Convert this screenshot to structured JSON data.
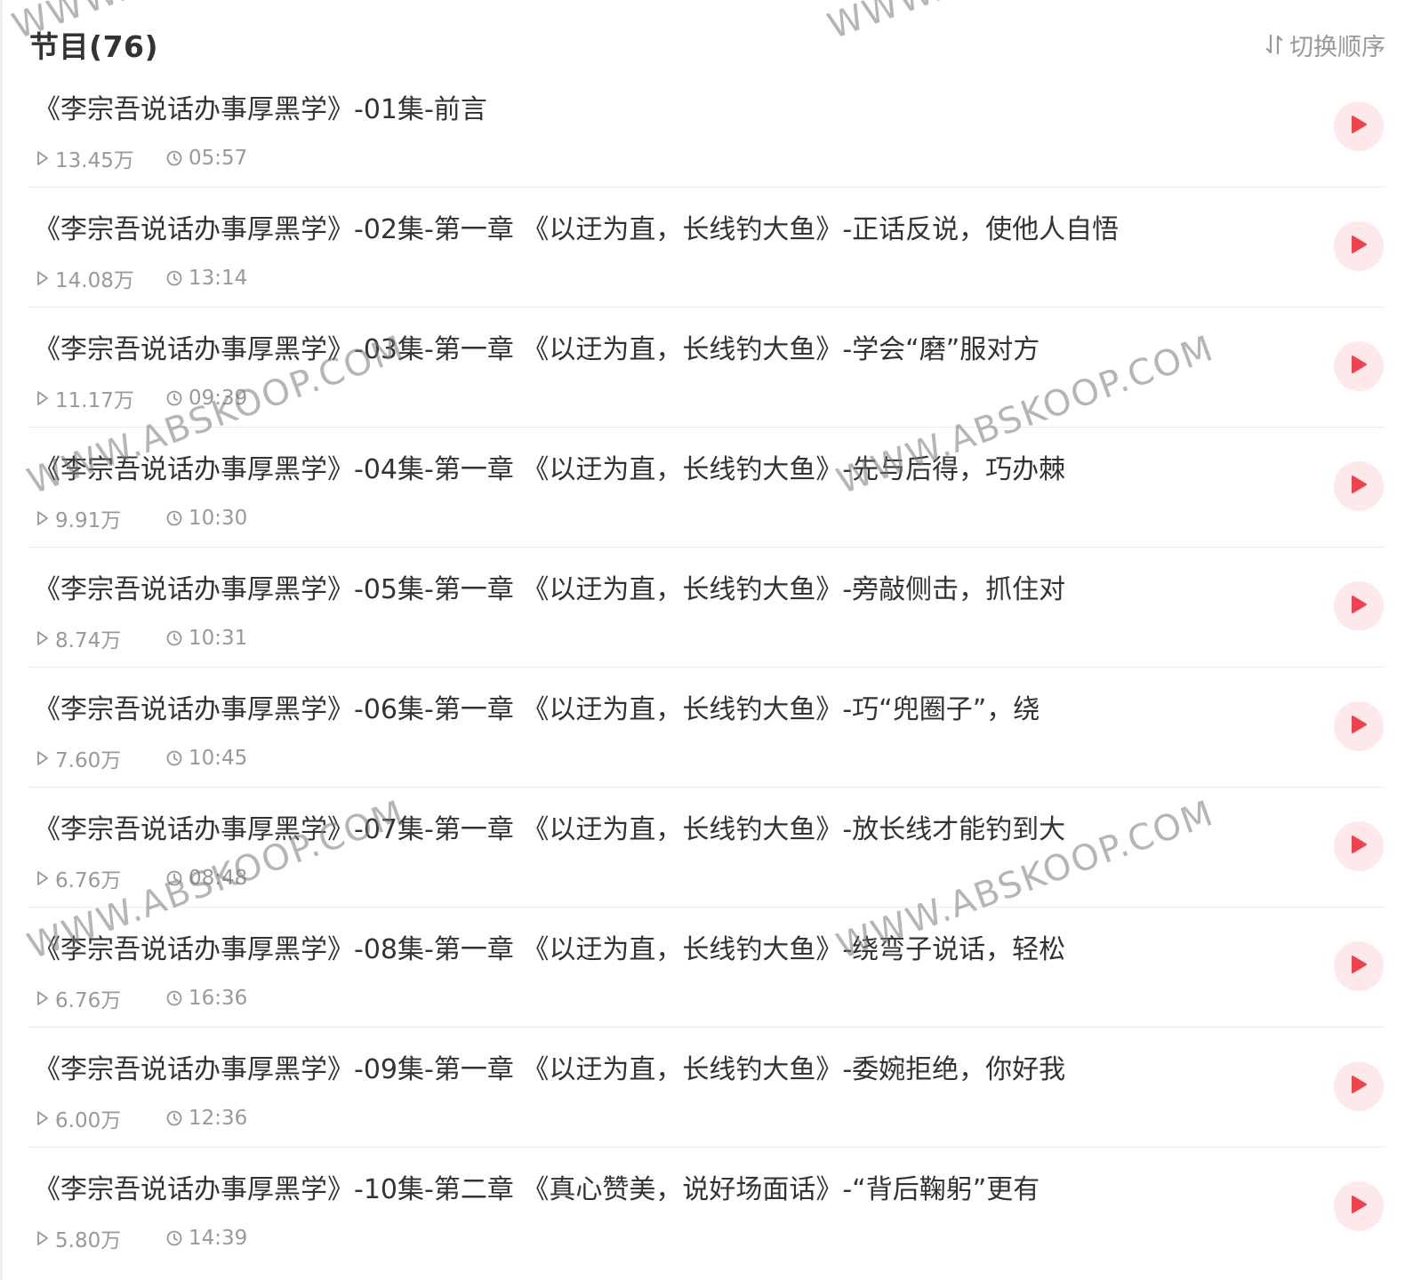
{
  "header": {
    "title": "节目(76)",
    "sort_label": "切换顺序"
  },
  "colors": {
    "accent": "#f0424d",
    "play_bg": "#fde9ea",
    "meta_text": "#999999"
  },
  "episodes": [
    {
      "title": "《李宗吾说话办事厚黑学》-01集-前言",
      "plays": "13.45万",
      "duration": "05:57"
    },
    {
      "title": "《李宗吾说话办事厚黑学》-02集-第一章 《以迂为直，长线钓大鱼》-正话反说，使他人自悟",
      "plays": "14.08万",
      "duration": "13:14"
    },
    {
      "title": "《李宗吾说话办事厚黑学》-03集-第一章 《以迂为直，长线钓大鱼》-学会“磨”服对方",
      "plays": "11.17万",
      "duration": "09:39"
    },
    {
      "title": "《李宗吾说话办事厚黑学》-04集-第一章 《以迂为直，长线钓大鱼》-先与后得，巧办棘",
      "plays": "9.91万",
      "duration": "10:30"
    },
    {
      "title": "《李宗吾说话办事厚黑学》-05集-第一章 《以迂为直，长线钓大鱼》-旁敲侧击，抓住对",
      "plays": "8.74万",
      "duration": "10:31"
    },
    {
      "title": "《李宗吾说话办事厚黑学》-06集-第一章 《以迂为直，长线钓大鱼》-巧“兜圈子”，绕",
      "plays": "7.60万",
      "duration": "10:45"
    },
    {
      "title": "《李宗吾说话办事厚黑学》-07集-第一章 《以迂为直，长线钓大鱼》-放长线才能钓到大",
      "plays": "6.76万",
      "duration": "08:48"
    },
    {
      "title": "《李宗吾说话办事厚黑学》-08集-第一章 《以迂为直，长线钓大鱼》-绕弯子说话，轻松",
      "plays": "6.76万",
      "duration": "16:36"
    },
    {
      "title": "《李宗吾说话办事厚黑学》-09集-第一章 《以迂为直，长线钓大鱼》-委婉拒绝，你好我",
      "plays": "6.00万",
      "duration": "12:36"
    },
    {
      "title": "《李宗吾说话办事厚黑学》-10集-第二章 《真心赞美，说好场面话》-“背后鞠躬”更有",
      "plays": "5.80万",
      "duration": "14:39"
    }
  ],
  "watermarks": {
    "text": "WWW.ABSKOOP.COM"
  }
}
